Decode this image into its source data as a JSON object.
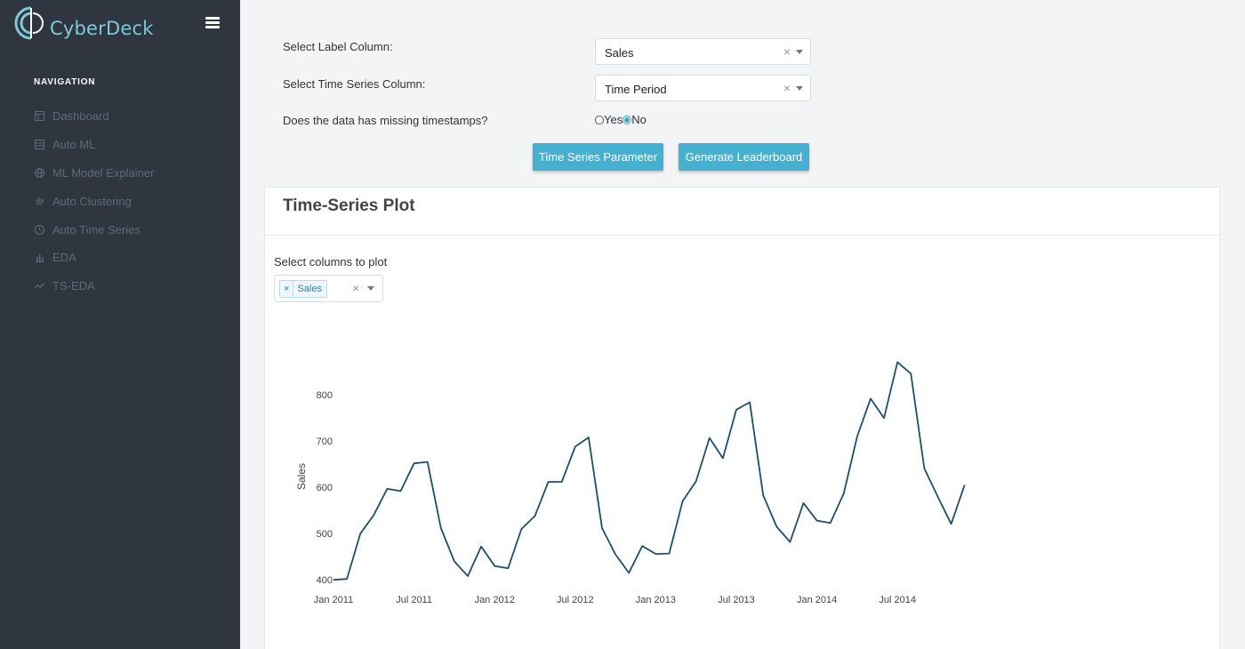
{
  "brand": {
    "name": "CyberDeck"
  },
  "sidebar": {
    "header": "NAVIGATION",
    "items": [
      {
        "label": "Dashboard",
        "icon": "dashboard-icon"
      },
      {
        "label": "Auto ML",
        "icon": "list-icon"
      },
      {
        "label": "ML Model Explainer",
        "icon": "globe-icon"
      },
      {
        "label": "Auto Clustering",
        "icon": "gear-icon"
      },
      {
        "label": "Auto Time Series",
        "icon": "clock-icon"
      },
      {
        "label": "EDA",
        "icon": "bar-chart-icon"
      },
      {
        "label": "TS-EDA",
        "icon": "line-chart-icon"
      }
    ]
  },
  "form": {
    "label_column": {
      "label": "Select Label Column:",
      "value": "Sales"
    },
    "time_column": {
      "label": "Select Time Series Column:",
      "value": "Time Period"
    },
    "missing": {
      "label": "Does the data has missing timestamps?",
      "yes": "Yes",
      "no": "No",
      "selected": "No"
    },
    "buttons": {
      "params": "Time Series Parameter",
      "leaderboard": "Generate Leaderboard"
    }
  },
  "card": {
    "title": "Time-Series Plot",
    "plot_label": "Select columns to plot",
    "selected_tag": "Sales"
  },
  "colors": {
    "accent": "#45b0cf",
    "line": "#1f4e6b",
    "sidebar": "#2f3640",
    "brand": "#7ec8da"
  },
  "chart_data": {
    "type": "line",
    "title": "",
    "xlabel": "",
    "ylabel": "Sales",
    "x_ticks": [
      "Jan 2011",
      "Jul 2011",
      "Jan 2012",
      "Jul 2012",
      "Jan 2013",
      "Jul 2013",
      "Jan 2014",
      "Jul 2014"
    ],
    "y_ticks": [
      400,
      500,
      600,
      700,
      800
    ],
    "ylim": [
      385,
      885
    ],
    "x_start": "Jan 2011",
    "series": [
      {
        "name": "Sales",
        "values": [
          400,
          402,
          500,
          540,
          597,
          592,
          652,
          655,
          512,
          440,
          408,
          472,
          430,
          425,
          510,
          538,
          612,
          612,
          688,
          708,
          512,
          455,
          415,
          473,
          456,
          457,
          570,
          613,
          707,
          663,
          768,
          784,
          583,
          515,
          482,
          566,
          528,
          523,
          587,
          710,
          792,
          750,
          871,
          846,
          641,
          580,
          521,
          605
        ]
      }
    ]
  }
}
